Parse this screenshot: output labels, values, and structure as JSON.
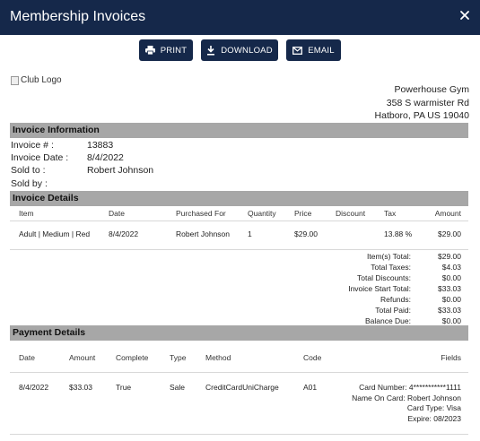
{
  "dialog": {
    "title": "Membership Invoices",
    "close_icon": "close-icon"
  },
  "toolbar": {
    "print_label": "PRINT",
    "download_label": "DOWNLOAD",
    "email_label": "EMAIL",
    "print_icon": "printer-icon",
    "download_icon": "download-icon",
    "email_icon": "envelope-icon"
  },
  "logo": {
    "alt": "Club Logo"
  },
  "club": {
    "name": "Powerhouse Gym",
    "street": "358 S warmister Rd",
    "city_line": "Hatboro, PA US 19040"
  },
  "invoice_info": {
    "heading": "Invoice Information",
    "rows": [
      {
        "label": "Invoice # :",
        "value": "13883"
      },
      {
        "label": "Invoice Date :",
        "value": "8/4/2022"
      },
      {
        "label": "Sold to :",
        "value": "Robert Johnson"
      },
      {
        "label": "Sold by :",
        "value": ""
      }
    ]
  },
  "invoice_details": {
    "heading": "Invoice Details",
    "columns": [
      "Item",
      "Date",
      "Purchased For",
      "Quantity",
      "Price",
      "Discount",
      "Tax",
      "Amount"
    ],
    "rows": [
      {
        "item": "Adult | Medium | Red",
        "date": "8/4/2022",
        "purchased_for": "Robert Johnson",
        "quantity": "1",
        "price": "$29.00",
        "discount": "",
        "tax": "13.88 %",
        "amount": "$29.00"
      }
    ]
  },
  "totals": [
    {
      "label": "Item(s) Total:",
      "value": "$29.00"
    },
    {
      "label": "Total Taxes:",
      "value": "$4.03"
    },
    {
      "label": "Total Discounts:",
      "value": "$0.00"
    },
    {
      "label": "Invoice Start Total:",
      "value": "$33.03"
    },
    {
      "label": "Refunds:",
      "value": "$0.00"
    },
    {
      "label": "Total Paid:",
      "value": "$33.03"
    },
    {
      "label": "Balance Due:",
      "value": "$0.00"
    }
  ],
  "payment_details": {
    "heading": "Payment Details",
    "columns": [
      "Date",
      "Amount",
      "Complete",
      "Type",
      "Method",
      "Code",
      "Fields"
    ],
    "rows": [
      {
        "date": "8/4/2022",
        "amount": "$33.03",
        "complete": "True",
        "type": "Sale",
        "method": "CreditCardUniCharge",
        "code": "A01",
        "fields": [
          "Card Number: 4***********1111",
          "Name On Card: Robert Johnson",
          "Card Type: Visa",
          "Expire: 08/2023"
        ]
      }
    ]
  },
  "colors": {
    "header_bg": "#15284a",
    "section_bg": "#a7a7a7",
    "text": "#222222"
  }
}
